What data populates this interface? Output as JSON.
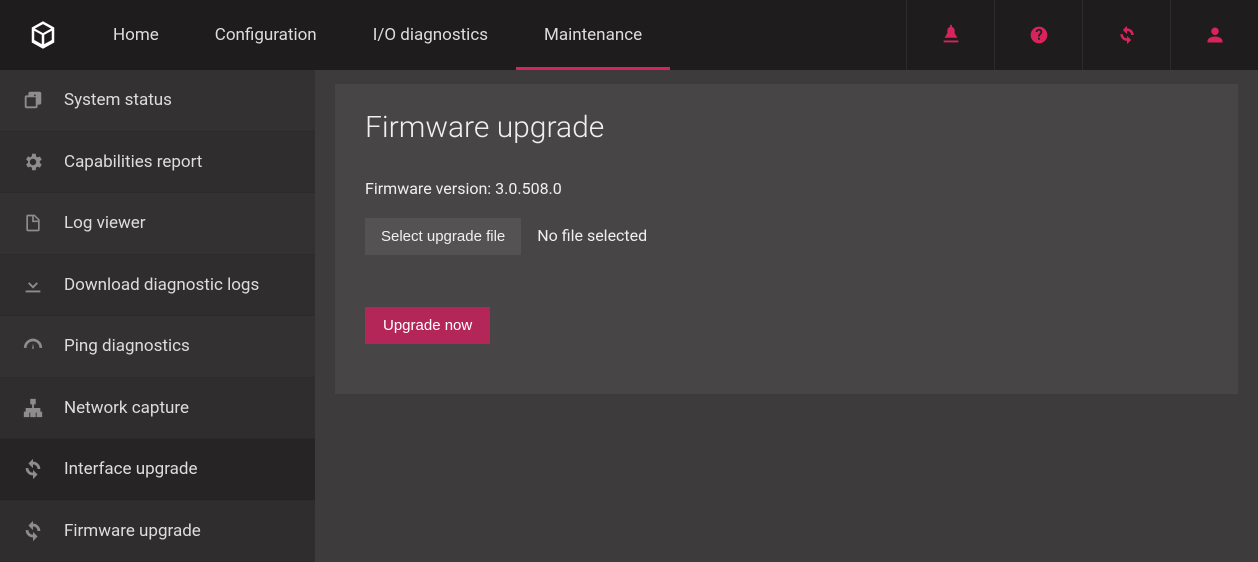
{
  "nav": {
    "items": [
      {
        "label": "Home"
      },
      {
        "label": "Configuration"
      },
      {
        "label": "I/O diagnostics"
      },
      {
        "label": "Maintenance",
        "active": true
      }
    ]
  },
  "sidebar": {
    "items": [
      {
        "label": "System status"
      },
      {
        "label": "Capabilities report"
      },
      {
        "label": "Log viewer"
      },
      {
        "label": "Download diagnostic logs"
      },
      {
        "label": "Ping diagnostics"
      },
      {
        "label": "Network capture"
      },
      {
        "label": "Interface upgrade",
        "active": true
      },
      {
        "label": "Firmware upgrade"
      }
    ]
  },
  "page": {
    "title": "Firmware upgrade",
    "version_label": "Firmware version:",
    "version_value": "3.0.508.0",
    "select_button": "Select upgrade file",
    "file_status": "No file selected",
    "upgrade_button": "Upgrade now"
  }
}
